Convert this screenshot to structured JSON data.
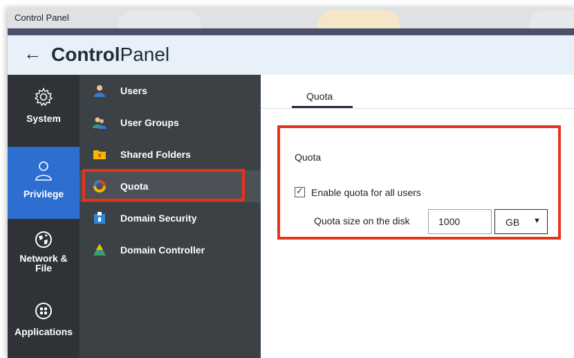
{
  "window": {
    "title": "Control Panel"
  },
  "header": {
    "back_icon": "arrow-left-icon",
    "brand_bold": "Control",
    "brand_light": "Panel"
  },
  "rail": {
    "items": [
      {
        "label": "System",
        "icon": "gear-icon",
        "active": false
      },
      {
        "label": "Privilege",
        "icon": "user-icon",
        "active": true
      },
      {
        "label": "Network &\nFile",
        "icon": "globe-icon",
        "active": false
      },
      {
        "label": "Applications",
        "icon": "apps-icon",
        "active": false
      }
    ]
  },
  "menu": {
    "items": [
      {
        "label": "Users",
        "icon": "user-icon"
      },
      {
        "label": "User Groups",
        "icon": "user-group-icon"
      },
      {
        "label": "Shared Folders",
        "icon": "shared-folder-icon"
      },
      {
        "label": "Quota",
        "icon": "quota-icon",
        "active": true
      },
      {
        "label": "Domain Security",
        "icon": "domain-security-icon"
      },
      {
        "label": "Domain Controller",
        "icon": "domain-controller-icon"
      }
    ]
  },
  "content": {
    "tabs": [
      {
        "label": "Quota",
        "active": true
      }
    ],
    "section_title": "Quota",
    "enable_quota": {
      "label": "Enable quota for all users",
      "checked": true
    },
    "quota_size": {
      "label": "Quota size on the disk",
      "value": "1000",
      "unit": "GB"
    }
  },
  "colors": {
    "accent": "#2c6fd1",
    "highlight": "#e8331b",
    "rail_bg": "#2f3338",
    "menu_bg": "#3c4146"
  }
}
